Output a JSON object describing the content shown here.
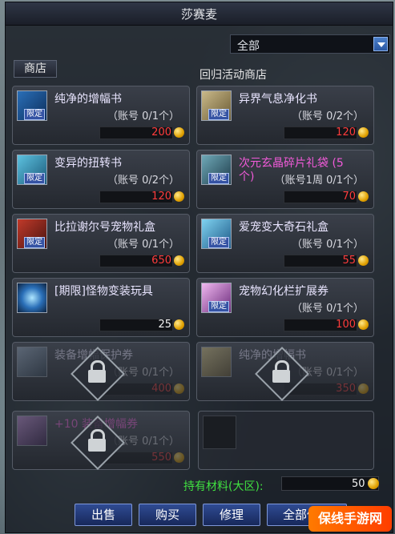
{
  "window": {
    "title": "莎赛麦"
  },
  "filter": {
    "selected": "全部"
  },
  "tab": {
    "label": "商店"
  },
  "shop_name": "回归活动商店",
  "badge_text": "限定",
  "items": [
    {
      "name": "纯净的增幅书",
      "limit": "（账号 0/1个）",
      "price": "200",
      "color": "normal"
    },
    {
      "name": "异界气息净化书",
      "limit": "（账号 0/2个）",
      "price": "120",
      "color": "normal"
    },
    {
      "name": "变异的扭转书",
      "limit": "（账号 0/2个）",
      "price": "120",
      "color": "normal"
    },
    {
      "name": "次元玄晶碎片礼袋 (5",
      "name2": "个)",
      "limit": "（账号1周 0/1个）",
      "price": "70",
      "color": "pink"
    },
    {
      "name": "比拉谢尔号宠物礼盒",
      "limit": "（账号 0/1个）",
      "price": "650",
      "color": "normal"
    },
    {
      "name": "爱宠变大奇石礼盒",
      "limit": "（账号 0/1个）",
      "price": "55",
      "color": "normal"
    },
    {
      "name": "[期限]怪物变装玩具",
      "limit": "",
      "price": "25",
      "color": "normal",
      "price_color": "white"
    },
    {
      "name": "宠物幻化栏扩展券",
      "limit": "（账号 0/1个）",
      "price": "100",
      "color": "normal"
    },
    {
      "name": "装备增幅保护券",
      "limit": "（账号 0/1个）",
      "price": "400",
      "color": "normal",
      "locked": true
    },
    {
      "name": "纯净的增幅书",
      "limit": "（账号 0/1个）",
      "price": "350",
      "color": "normal",
      "locked": true
    },
    {
      "name": "+10 装备增幅券",
      "limit": "（账号 0/1个）",
      "price": "550",
      "color": "pink",
      "locked": true
    }
  ],
  "materials": {
    "label": "持有材料(大区):",
    "value": "50"
  },
  "buttons": {
    "sell": "出售",
    "buy": "购买",
    "repair": "修理",
    "repair_all": "全部修理"
  },
  "watermark": "保线手游网"
}
